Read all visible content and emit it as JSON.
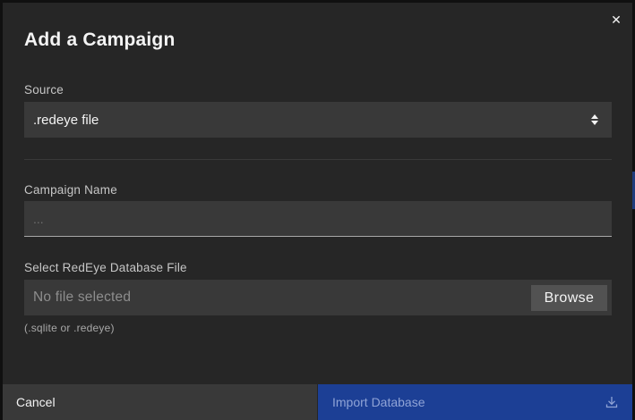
{
  "dialog": {
    "title": "Add a Campaign",
    "close_glyph": "✕"
  },
  "source": {
    "label": "Source",
    "selected": ".redeye file"
  },
  "campaign_name": {
    "label": "Campaign Name",
    "value": "",
    "placeholder": "..."
  },
  "database_file": {
    "label": "Select RedEye Database File",
    "status": "No file selected",
    "browse_label": "Browse",
    "helper": "(.sqlite or .redeye)"
  },
  "footer": {
    "cancel_label": "Cancel",
    "import_label": "Import Database"
  },
  "icons": {
    "close": "close-icon",
    "select_caret": "sort-caret-icon",
    "import": "download-icon"
  },
  "colors": {
    "modal_bg": "#262626",
    "field_bg": "#393939",
    "primary_button": "#1c3f95",
    "text": "#f4f4f4"
  }
}
